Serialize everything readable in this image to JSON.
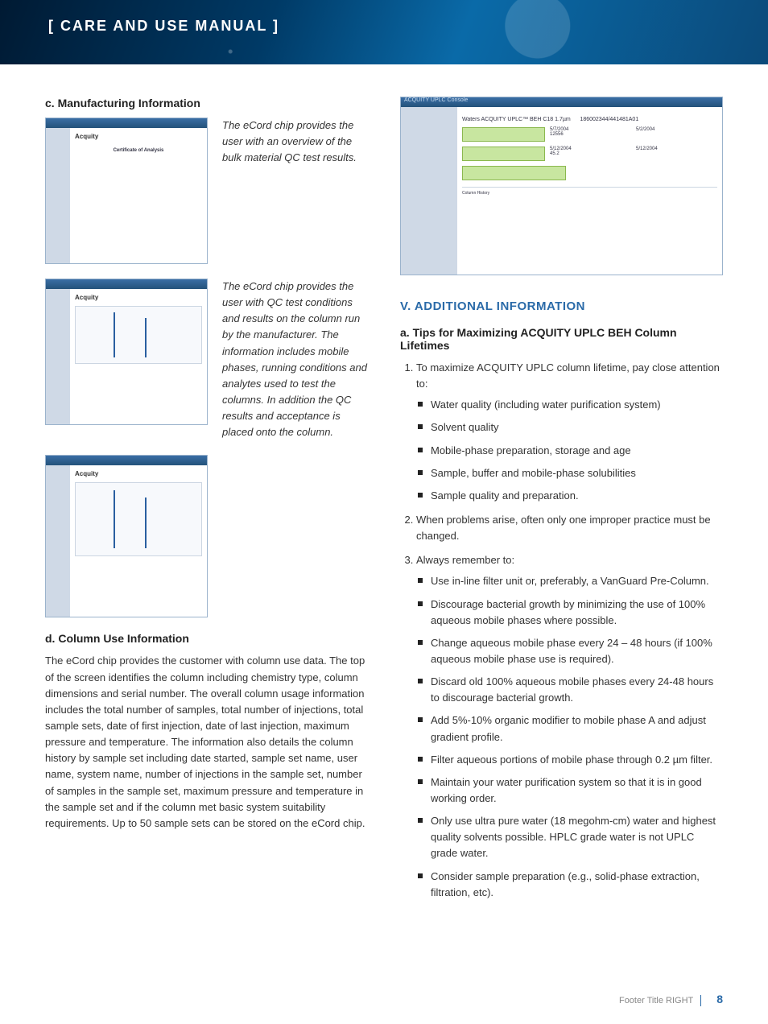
{
  "hero": {
    "title": "[ CARE AND USE MANUAL ]"
  },
  "left": {
    "c_heading": "c. Manufacturing Information",
    "caption1": "The eCord chip provides the user with an overview of the bulk material QC test results.",
    "caption2": "The eCord chip provides the user with QC test conditions and results on the column run by the manufacturer. The information includes mobile phases, running conditions and analytes used to test the columns. In addition the QC results and acceptance is placed onto the column.",
    "d_heading": "d. Column Use Information",
    "d_body": "The eCord chip provides the customer with column use data. The top of the screen identifies the column including chemistry type, column dimensions and serial number. The overall column usage information includes the total number of samples, total number of injections, total sample sets, date of first injection, date of last injection, maximum pressure and temperature. The information also details the column history by sample set including date started, sample set name, user name, system name, number of injections in the sample set, number of samples in the sample set, maximum pressure and temperature in the sample set and if the column met basic system suitability requirements. Up to 50 sample sets can be stored on the eCord chip."
  },
  "shots": {
    "cert_title": "Certificate of Analysis",
    "console_title": "ACQUITY UPLC Console",
    "column_desc": "Waters ACQUITY UPLC™ BEH C18 1.7µm",
    "part_serial": "186002344/441481A01"
  },
  "right": {
    "section": "V. ADDITIONAL INFORMATION",
    "a_heading": "a. Tips for Maximizing ACQUITY UPLC BEH Column Lifetimes",
    "li1": "To maximize ACQUITY UPLC column lifetime, pay close attention to:",
    "li1_items": [
      "Water quality (including water purification system)",
      "Solvent quality",
      "Mobile-phase preparation, storage and age",
      "Sample, buffer and mobile-phase solubilities",
      "Sample quality and preparation."
    ],
    "li2": "When problems arise, often only one improper practice must be changed.",
    "li3": "Always remember to:",
    "li3_items": [
      "Use in-line filter unit or, preferably, a VanGuard Pre-Column.",
      "Discourage bacterial growth by minimizing the use of 100% aqueous mobile phases where possible.",
      "Change aqueous mobile phase every 24 – 48 hours (if 100% aqueous mobile phase use is required).",
      "Discard old 100% aqueous mobile phases every 24-48 hours to discourage bacterial growth.",
      "Add 5%-10% organic modifier to mobile phase A and adjust gradient profile.",
      "Filter aqueous portions of mobile phase through 0.2 µm filter.",
      "Maintain your water purification system so that it is in good working order.",
      "Only use ultra pure water (18 megohm-cm) water and highest quality solvents possible. HPLC grade water is not UPLC grade water.",
      "Consider sample preparation (e.g., solid-phase extraction, filtration, etc)."
    ]
  },
  "footer": {
    "label": "Footer Title RIGHT",
    "page": "8"
  }
}
